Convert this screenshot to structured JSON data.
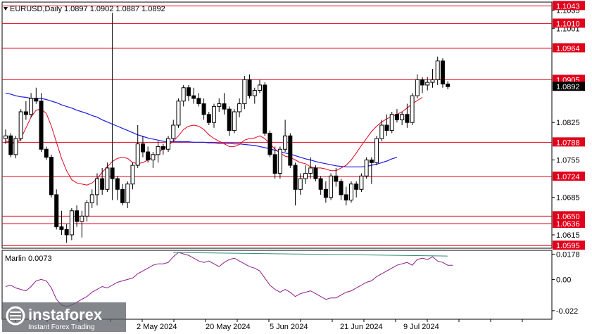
{
  "chart_data": [
    {
      "type": "candlestick",
      "title": "EURUSD,Daily  1.0897 1.0902 1.0887 1.0892",
      "ylim": [
        1.059,
        1.105
      ],
      "y_ticks": [
        "1.1043",
        "1.1035",
        "1.1010",
        "1.1001",
        "1.0964",
        "1.0905",
        "1.0892",
        "1.0825",
        "1.0788",
        "1.0755",
        "1.0724",
        "1.0685",
        "1.0650",
        "1.0636",
        "1.0615",
        "1.0595"
      ],
      "x_tick_labels": [
        "2 May 2024",
        "20 May 2024",
        "5 Jun 2024",
        "21 Jun 2024",
        "9 Jul 2024"
      ],
      "levels": [
        {
          "label": "1.1043",
          "value": 1.1043
        },
        {
          "label": "1.1010",
          "value": 1.101
        },
        {
          "label": "1.0964",
          "value": 1.0964
        },
        {
          "label": "1.0905",
          "value": 1.0905
        },
        {
          "label": "1.0788",
          "value": 1.0788
        },
        {
          "label": "1.0724",
          "value": 1.0724
        },
        {
          "label": "1.0650",
          "value": 1.065
        },
        {
          "label": "1.0636",
          "value": 1.0636
        },
        {
          "label": "1.0595",
          "value": 1.0595
        }
      ],
      "last_price": {
        "label": "1.0892",
        "value": 1.0892
      },
      "candles": [
        [
          1.0795,
          1.0812,
          1.0785,
          1.08
        ],
        [
          1.08,
          1.0805,
          1.076,
          1.0765
        ],
        [
          1.0765,
          1.08,
          1.0758,
          1.0795
        ],
        [
          1.0795,
          1.085,
          1.079,
          1.0845
        ],
        [
          1.0845,
          1.0865,
          1.083,
          1.084
        ],
        [
          1.084,
          1.088,
          1.0835,
          1.087
        ],
        [
          1.087,
          1.089,
          1.086,
          1.0865
        ],
        [
          1.0865,
          1.088,
          1.077,
          1.0775
        ],
        [
          1.0775,
          1.078,
          1.0755,
          1.076
        ],
        [
          1.076,
          1.0765,
          1.0685,
          1.069
        ],
        [
          1.069,
          1.07,
          1.0625,
          1.063
        ],
        [
          1.063,
          1.066,
          1.0615,
          1.0625
        ],
        [
          1.0625,
          1.0635,
          1.06,
          1.0615
        ],
        [
          1.0615,
          1.0665,
          1.0605,
          1.066
        ],
        [
          1.066,
          1.067,
          1.063,
          1.064
        ],
        [
          1.064,
          1.066,
          1.061,
          1.065
        ],
        [
          1.065,
          1.068,
          1.064,
          1.0675
        ],
        [
          1.0675,
          1.07,
          1.0665,
          1.069
        ],
        [
          1.069,
          1.073,
          1.067,
          1.072
        ],
        [
          1.072,
          1.074,
          1.069,
          1.07
        ],
        [
          1.07,
          1.075,
          1.0695,
          1.074
        ],
        [
          1.074,
          1.103,
          1.068,
          1.072
        ],
        [
          1.072,
          1.0725,
          1.068,
          1.07
        ],
        [
          1.07,
          1.071,
          1.067,
          1.0675
        ],
        [
          1.0675,
          1.0715,
          1.0665,
          1.071
        ],
        [
          1.071,
          1.075,
          1.07,
          1.0745
        ],
        [
          1.0745,
          1.082,
          1.074,
          1.0785
        ],
        [
          1.0785,
          1.08,
          1.076,
          1.077
        ],
        [
          1.077,
          1.078,
          1.075,
          1.0755
        ],
        [
          1.0755,
          1.077,
          1.074,
          1.0765
        ],
        [
          1.0765,
          1.079,
          1.075,
          1.078
        ],
        [
          1.078,
          1.0785,
          1.0765,
          1.0775
        ],
        [
          1.0775,
          1.08,
          1.077,
          1.0795
        ],
        [
          1.0795,
          1.083,
          1.079,
          1.082
        ],
        [
          1.082,
          1.087,
          1.0815,
          1.0865
        ],
        [
          1.0865,
          1.0895,
          1.0855,
          1.089
        ],
        [
          1.089,
          1.0895,
          1.0865,
          1.0875
        ],
        [
          1.0875,
          1.089,
          1.086,
          1.087
        ],
        [
          1.087,
          1.088,
          1.0855,
          1.086
        ],
        [
          1.086,
          1.087,
          1.083,
          1.084
        ],
        [
          1.084,
          1.0845,
          1.082,
          1.0825
        ],
        [
          1.0825,
          1.086,
          1.0815,
          1.0855
        ],
        [
          1.0855,
          1.087,
          1.0845,
          1.086
        ],
        [
          1.086,
          1.088,
          1.084,
          1.085
        ],
        [
          1.085,
          1.0855,
          1.08,
          1.081
        ],
        [
          1.081,
          1.085,
          1.0805,
          1.0845
        ],
        [
          1.0845,
          1.087,
          1.0835,
          1.086
        ],
        [
          1.086,
          1.0912,
          1.085,
          1.0905
        ],
        [
          1.0905,
          1.0915,
          1.087,
          1.0875
        ],
        [
          1.0875,
          1.089,
          1.086,
          1.0885
        ],
        [
          1.0885,
          1.0905,
          1.088,
          1.0895
        ],
        [
          1.0895,
          1.09,
          1.08,
          1.0805
        ],
        [
          1.0805,
          1.081,
          1.076,
          1.0765
        ],
        [
          1.0765,
          1.078,
          1.072,
          1.073
        ],
        [
          1.073,
          1.078,
          1.072,
          1.0775
        ],
        [
          1.0775,
          1.083,
          1.077,
          1.08
        ],
        [
          1.08,
          1.0805,
          1.074,
          1.0745
        ],
        [
          1.0745,
          1.075,
          1.067,
          1.07
        ],
        [
          1.07,
          1.073,
          1.069,
          1.072
        ],
        [
          1.072,
          1.0745,
          1.071,
          1.073
        ],
        [
          1.073,
          1.076,
          1.072,
          1.074
        ],
        [
          1.074,
          1.0745,
          1.0715,
          1.072
        ],
        [
          1.072,
          1.0725,
          1.069,
          1.07
        ],
        [
          1.07,
          1.0715,
          1.0675,
          1.0685
        ],
        [
          1.0685,
          1.073,
          1.068,
          1.0725
        ],
        [
          1.0725,
          1.074,
          1.0705,
          1.0715
        ],
        [
          1.0715,
          1.072,
          1.068,
          1.069
        ],
        [
          1.069,
          1.0705,
          1.067,
          1.068
        ],
        [
          1.068,
          1.0715,
          1.0675,
          1.071
        ],
        [
          1.071,
          1.0715,
          1.0685,
          1.07
        ],
        [
          1.07,
          1.073,
          1.0695,
          1.0725
        ],
        [
          1.0725,
          1.076,
          1.072,
          1.0755
        ],
        [
          1.0755,
          1.076,
          1.071,
          1.075
        ],
        [
          1.075,
          1.08,
          1.0745,
          1.0795
        ],
        [
          1.0795,
          1.083,
          1.079,
          1.082
        ],
        [
          1.082,
          1.084,
          1.08,
          1.081
        ],
        [
          1.081,
          1.0845,
          1.0805,
          1.084
        ],
        [
          1.084,
          1.085,
          1.0825,
          1.083
        ],
        [
          1.083,
          1.0845,
          1.082,
          1.084
        ],
        [
          1.084,
          1.086,
          1.0815,
          1.0825
        ],
        [
          1.0825,
          1.088,
          1.082,
          1.0875
        ],
        [
          1.0875,
          1.0915,
          1.087,
          1.0905
        ],
        [
          1.0905,
          1.091,
          1.088,
          1.0895
        ],
        [
          1.0895,
          1.091,
          1.0885,
          1.09
        ],
        [
          1.09,
          1.0925,
          1.089,
          1.0905
        ],
        [
          1.0905,
          1.0948,
          1.0895,
          1.094
        ],
        [
          1.094,
          1.0945,
          1.089,
          1.0897
        ],
        [
          1.0897,
          1.0902,
          1.0887,
          1.0892
        ]
      ],
      "ma_fast": [
        1.079,
        1.0788,
        1.0785,
        1.0795,
        1.0815,
        1.0835,
        1.0848,
        1.085,
        1.0842,
        1.0818,
        1.0788,
        1.0758,
        1.0735,
        1.0718,
        1.0712,
        1.071,
        1.0708,
        1.0712,
        1.072,
        1.0732,
        1.0742,
        1.0752,
        1.0758,
        1.076,
        1.0758,
        1.075,
        1.0748,
        1.075,
        1.0755,
        1.076,
        1.0768,
        1.0776,
        1.0782,
        1.079,
        1.08,
        1.0812,
        1.0818,
        1.082,
        1.0818,
        1.0812,
        1.0802,
        1.0795,
        1.079,
        1.0785,
        1.078,
        1.078,
        1.0784,
        1.0792,
        1.0795,
        1.0796,
        1.08,
        1.0795,
        1.0785,
        1.0775,
        1.0768,
        1.0762,
        1.076,
        1.0755,
        1.075,
        1.0748,
        1.0742,
        1.074,
        1.074,
        1.0738,
        1.0735,
        1.0735,
        1.074,
        1.0745,
        1.0755,
        1.0768,
        1.0782,
        1.0795,
        1.0808,
        1.0818,
        1.0826,
        1.0832,
        1.0836,
        1.084,
        1.0845,
        1.0852,
        1.086,
        1.0866,
        1.0872
      ],
      "ma_slow": [
        1.088,
        1.0878,
        1.0875,
        1.0873,
        1.0872,
        1.087,
        1.087,
        1.087,
        1.0868,
        1.0865,
        1.0862,
        1.0858,
        1.0855,
        1.0852,
        1.0848,
        1.0845,
        1.0842,
        1.0838,
        1.0835,
        1.083,
        1.0826,
        1.0822,
        1.0818,
        1.0814,
        1.081,
        1.0806,
        1.0802,
        1.0799,
        1.0796,
        1.0794,
        1.0792,
        1.079,
        1.0789,
        1.0789,
        1.0789,
        1.0789,
        1.0789,
        1.0788,
        1.0788,
        1.0788,
        1.0787,
        1.0787,
        1.0786,
        1.0786,
        1.0786,
        1.0785,
        1.0785,
        1.0784,
        1.0783,
        1.0782,
        1.078,
        1.0778,
        1.0776,
        1.0773,
        1.077,
        1.0768,
        1.0766,
        1.0763,
        1.076,
        1.0757,
        1.0755,
        1.0752,
        1.075,
        1.0748,
        1.0746,
        1.0744,
        1.0743,
        1.0742,
        1.0742,
        1.0742,
        1.0742,
        1.0743,
        1.0745,
        1.0747,
        1.075,
        1.0753,
        1.0757,
        1.076
      ],
      "ma_fast_start": 0,
      "ma_slow_start": 0
    },
    {
      "type": "line",
      "title": "Marlin 0.0073",
      "ylim": [
        -0.028,
        0.0205
      ],
      "y_ticks": [
        "0.0178",
        "0.00",
        "-0.022"
      ],
      "values": [
        -0.005,
        -0.004,
        -0.006,
        -0.007,
        -0.008,
        -0.005,
        -0.001,
        0.0,
        -0.001,
        -0.006,
        -0.014,
        -0.018,
        -0.019,
        -0.018,
        -0.016,
        -0.014,
        -0.012,
        -0.009,
        -0.007,
        -0.005,
        -0.006,
        -0.004,
        -0.002,
        -0.001,
        0.0,
        0.001,
        0.004,
        0.006,
        0.008,
        0.01,
        0.011,
        0.011,
        0.012,
        0.016,
        0.019,
        0.018,
        0.017,
        0.015,
        0.013,
        0.012,
        0.013,
        0.011,
        0.009,
        0.012,
        0.014,
        0.015,
        0.013,
        0.011,
        0.009,
        0.008,
        0.006,
        0.001,
        -0.004,
        -0.007,
        -0.009,
        -0.007,
        -0.009,
        -0.012,
        -0.01,
        -0.009,
        -0.008,
        -0.01,
        -0.012,
        -0.014,
        -0.013,
        -0.013,
        -0.011,
        -0.009,
        -0.008,
        -0.006,
        -0.004,
        -0.002,
        -0.001,
        0.002,
        0.004,
        0.006,
        0.008,
        0.01,
        0.011,
        0.012,
        0.01,
        0.014,
        0.015,
        0.014,
        0.016,
        0.013,
        0.012,
        0.01,
        0.01
      ],
      "signal_line": [
        [
          33,
          0.019
        ],
        [
          87,
          0.0165
        ]
      ]
    }
  ]
}
